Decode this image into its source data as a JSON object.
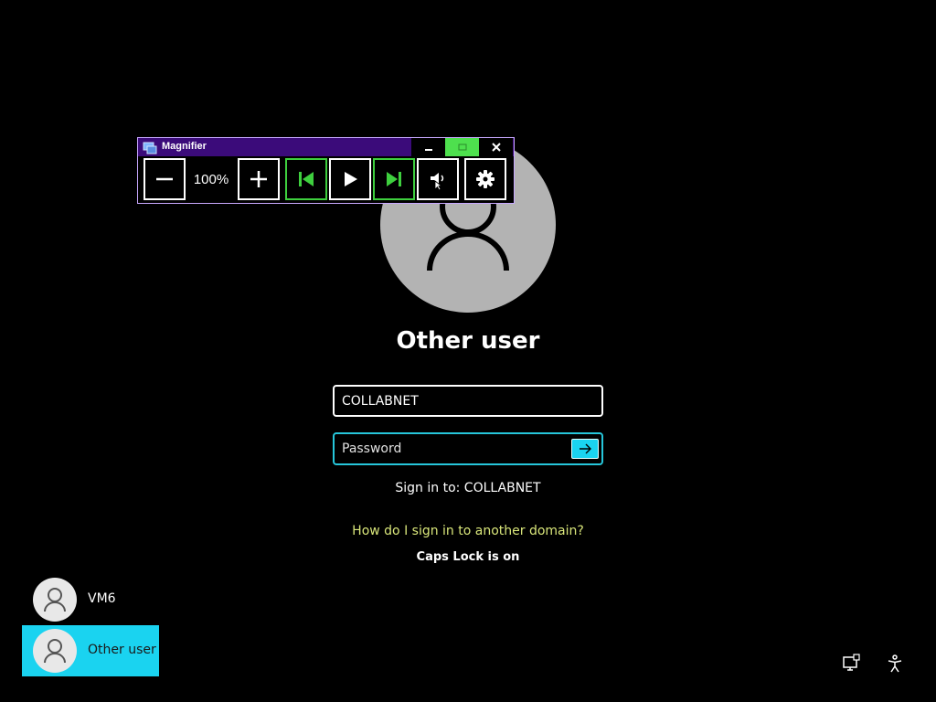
{
  "magnifier": {
    "title": "Magnifier",
    "zoom_level": "100%",
    "icons": {
      "app": "magnifier-app-icon",
      "minimize": "minimize-icon",
      "restore": "restore-icon",
      "close": "close-icon",
      "zoom_out": "minus-icon",
      "zoom_in": "plus-icon",
      "previous": "skip-previous-icon",
      "play": "play-icon",
      "next": "skip-next-icon",
      "read_from_here": "speaker-pointer-icon",
      "settings": "gear-icon"
    },
    "colors": {
      "titlebar": "#3b0b7a",
      "accent_green": "#3ecf3e"
    }
  },
  "login": {
    "user_name": "Other user",
    "username_value": "COLLABNET",
    "password_placeholder": "Password",
    "sign_in_to": "Sign in to: COLLABNET",
    "other_domain_link": "How do I sign in to another domain?",
    "caps_lock": "Caps Lock is on",
    "colors": {
      "accent": "#1ad3f0",
      "link": "#d9e67a"
    }
  },
  "users": [
    {
      "label": "VM6",
      "selected": false
    },
    {
      "label": "Other user",
      "selected": true
    }
  ],
  "corner_icons": {
    "network": "network-icon",
    "accessibility": "accessibility-icon"
  }
}
